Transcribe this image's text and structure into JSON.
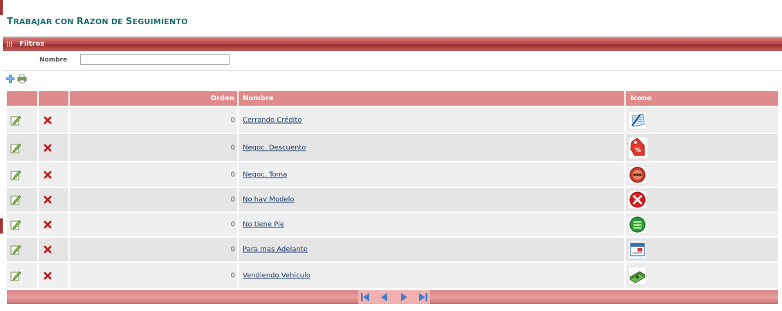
{
  "page": {
    "title_initial": "T",
    "title_rest": "RABAJAR CON ",
    "title_initial2": "R",
    "title_rest2": "AZON DE ",
    "title_initial3": "S",
    "title_rest3": "EGUIMIENTO"
  },
  "filters": {
    "header": "Filtros",
    "name_label": "Nombre",
    "name_value": ""
  },
  "toolbar": {
    "add_icon": "add-icon",
    "print_icon": "print-icon"
  },
  "grid": {
    "columns": [
      "",
      "",
      "Orden",
      "Nombre",
      "Icono"
    ],
    "rows": [
      {
        "orden": "0",
        "nombre": "Cerrando Crédito",
        "icon": "signing-document-icon"
      },
      {
        "orden": "0",
        "nombre": "Negoc. Descuento",
        "icon": "discount-tag-icon"
      },
      {
        "orden": "0",
        "nombre": "Negoc. Toma",
        "icon": "negotiation-badge-icon"
      },
      {
        "orden": "0",
        "nombre": "No hay Modelo",
        "icon": "red-x-icon"
      },
      {
        "orden": "0",
        "nombre": "No tiene Pie",
        "icon": "coins-stack-icon"
      },
      {
        "orden": "0",
        "nombre": "Para mas Adelante",
        "icon": "calendar-icon"
      },
      {
        "orden": "0",
        "nombre": "Vendiendo Vehiculo",
        "icon": "money-icon"
      }
    ]
  },
  "colors": {
    "accent": "#a03636",
    "title": "#1a6b6b",
    "header": "#e08b8b",
    "link": "#1f3d6b"
  }
}
